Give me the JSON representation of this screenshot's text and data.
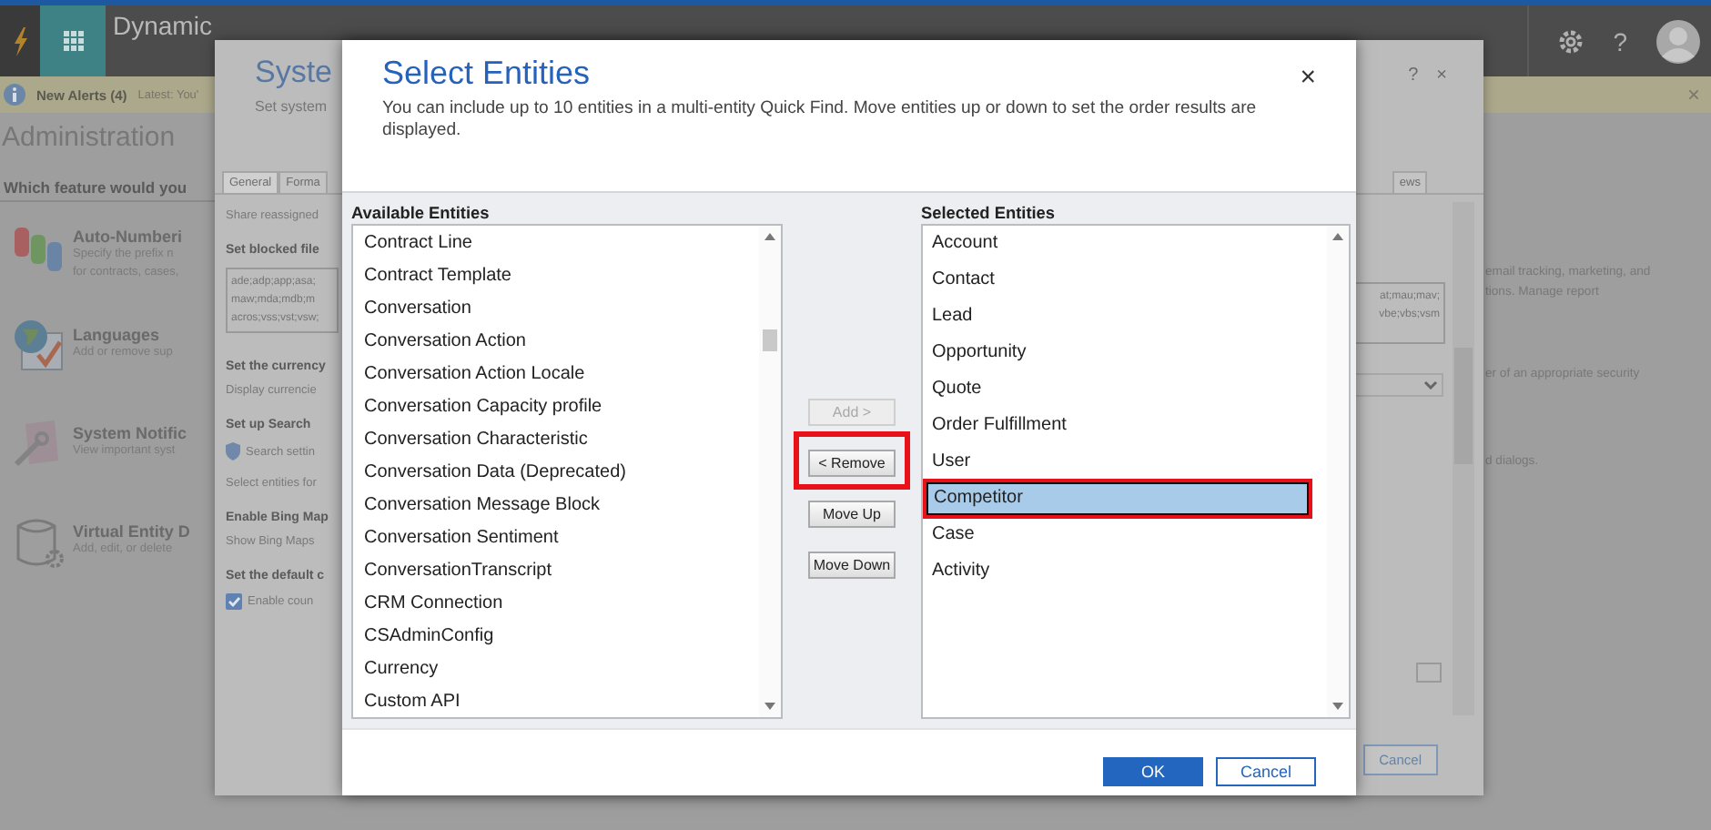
{
  "app_bar": {
    "brand": "Dynamic",
    "help": "?"
  },
  "alerts": {
    "title": "New Alerts (4)",
    "latest": "Latest: You'",
    "close": "×"
  },
  "page": {
    "title": "Administration",
    "prompt": "Which feature would you",
    "features": [
      {
        "kind": "numbering",
        "name": "Auto-Numberi",
        "description": [
          "Specify the prefix n",
          "for contracts, cases,"
        ]
      },
      {
        "kind": "languages",
        "name": "Languages",
        "description": [
          "Add or remove sup"
        ]
      },
      {
        "kind": "notifications",
        "name": "System Notific",
        "description": [
          "View important syst"
        ]
      },
      {
        "kind": "virtual",
        "name": "Virtual Entity D",
        "description": [
          "Add, edit, or delete"
        ]
      }
    ],
    "right_texts": [
      "email tracking, marketing, and",
      "tions. Manage report",
      "er of an appropriate security",
      "d dialogs."
    ]
  },
  "system_dialog": {
    "title": "Syste",
    "subtitle": "Set system",
    "help": "?",
    "close": "×",
    "tabs": [
      {
        "label": "General",
        "selected": true
      },
      {
        "label": "Forma",
        "selected": false
      },
      {
        "label": "ews",
        "selected": false
      }
    ],
    "left_items": [
      {
        "kind": "text",
        "text": "Share reassigned"
      },
      {
        "kind": "heading",
        "text": "Set blocked file"
      },
      {
        "kind": "textarea",
        "lines": [
          "ade;adp;app;asa;",
          "maw;mda;mdb;m",
          "acros;vss;vst;vsw;"
        ]
      },
      {
        "kind": "heading",
        "text": "Set the currency"
      },
      {
        "kind": "text",
        "text": "Display currencie"
      },
      {
        "kind": "heading",
        "text": "Set up Search"
      },
      {
        "kind": "notice",
        "text": "Search settin"
      },
      {
        "kind": "text",
        "text": "Select entities for"
      },
      {
        "kind": "heading",
        "text": "Enable Bing Map"
      },
      {
        "kind": "text",
        "text": "Show Bing Maps"
      },
      {
        "kind": "heading",
        "text": "Set the default c"
      },
      {
        "kind": "checkbox",
        "text": "Enable coun",
        "checked": true
      }
    ],
    "right_textarea": [
      "at;mau;mav;",
      "vbe;vbs;vsm"
    ],
    "cancel": "Cancel"
  },
  "entities_dialog": {
    "title": "Select Entities",
    "description": "You can include up to 10 entities in a multi-entity Quick Find. Move entities up or down to set the order results are displayed.",
    "close": "×",
    "available": {
      "label": "Available Entities",
      "items": [
        {
          "label": "Contract Line",
          "selected": false
        },
        {
          "label": "Contract Template",
          "selected": false
        },
        {
          "label": "Conversation",
          "selected": false
        },
        {
          "label": "Conversation Action",
          "selected": false
        },
        {
          "label": "Conversation Action Locale",
          "selected": false
        },
        {
          "label": "Conversation Capacity profile",
          "selected": false
        },
        {
          "label": "Conversation Characteristic",
          "selected": false
        },
        {
          "label": "Conversation Data (Deprecated)",
          "selected": false
        },
        {
          "label": "Conversation Message Block",
          "selected": false
        },
        {
          "label": "Conversation Sentiment",
          "selected": false
        },
        {
          "label": "ConversationTranscript",
          "selected": false
        },
        {
          "label": "CRM Connection",
          "selected": false
        },
        {
          "label": "CSAdminConfig",
          "selected": false
        },
        {
          "label": "Currency",
          "selected": false
        },
        {
          "label": "Custom API",
          "selected": false
        }
      ]
    },
    "buttons": [
      {
        "label": "Add >",
        "disabled": true,
        "highlighted": false
      },
      {
        "label": "< Remove",
        "disabled": false,
        "highlighted": true
      },
      {
        "label": "Move Up",
        "disabled": false,
        "highlighted": false
      },
      {
        "label": "Move Down",
        "disabled": false,
        "highlighted": false
      }
    ],
    "selected": {
      "label": "Selected Entities",
      "items": [
        {
          "label": "Account",
          "selected": false,
          "highlighted": false
        },
        {
          "label": "Contact",
          "selected": false,
          "highlighted": false
        },
        {
          "label": "Lead",
          "selected": false,
          "highlighted": false
        },
        {
          "label": "Opportunity",
          "selected": false,
          "highlighted": false
        },
        {
          "label": "Quote",
          "selected": false,
          "highlighted": false
        },
        {
          "label": "Order Fulfillment",
          "selected": false,
          "highlighted": false
        },
        {
          "label": "User",
          "selected": false,
          "highlighted": false
        },
        {
          "label": "Competitor",
          "selected": true,
          "highlighted": true
        },
        {
          "label": "Case",
          "selected": false,
          "highlighted": false
        },
        {
          "label": "Activity",
          "selected": false,
          "highlighted": false
        }
      ]
    },
    "footer_buttons": [
      {
        "label": "OK",
        "primary": true
      },
      {
        "label": "Cancel",
        "primary": false
      }
    ]
  }
}
